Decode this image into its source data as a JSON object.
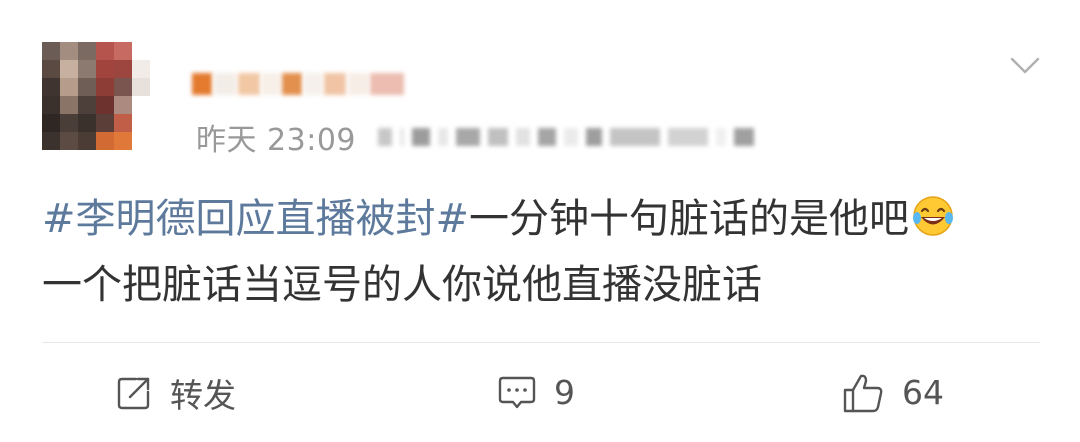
{
  "post": {
    "timestamp": "昨天 23:09",
    "hashtag": "#李明德回应直播被封#",
    "text_line1_rest": "一分钟十句脏话的是他吧",
    "emoji": "laughing-tears-emoji",
    "text_line2": "一个把脏话当逗号的人你说他直播没脏话"
  },
  "actions": {
    "repost_label": "转发",
    "comment_count": "9",
    "like_count": "64"
  },
  "colors": {
    "text": "#333333",
    "hashtag": "#5d7a9c",
    "meta": "#999999",
    "icon": "#555555",
    "divider": "#e6e6e6"
  },
  "icons": {
    "menu": "chevron-down-icon",
    "repost": "repost-icon",
    "comment": "comment-icon",
    "like": "thumbs-up-icon"
  }
}
